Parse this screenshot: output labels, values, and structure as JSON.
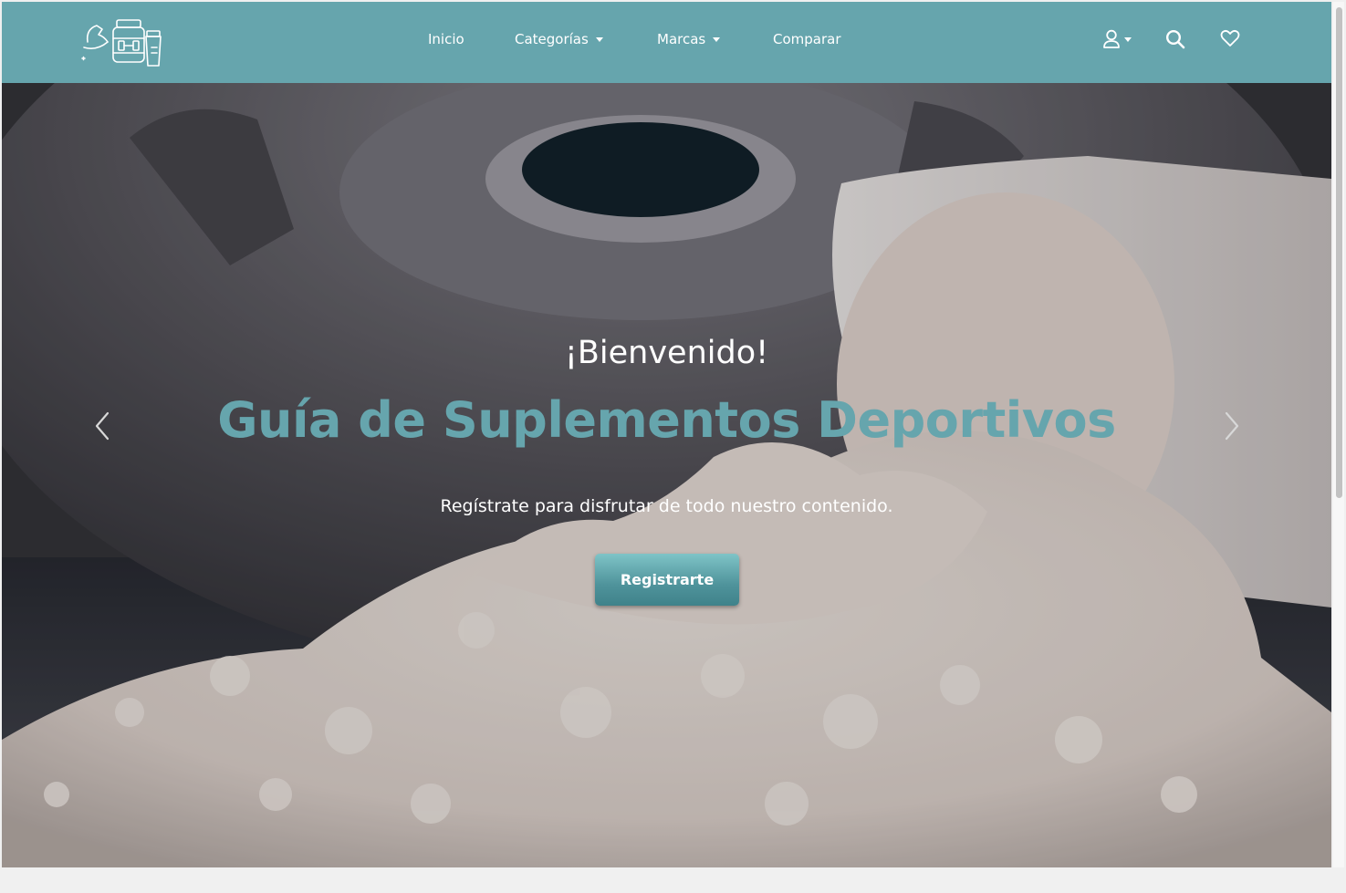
{
  "nav": {
    "logo_name": "supplements-logo",
    "links": [
      {
        "label": "Inicio"
      },
      {
        "label": "Categorías"
      },
      {
        "label": "Marcas"
      },
      {
        "label": "Comparar"
      }
    ],
    "icons": [
      "user-icon",
      "search-icon",
      "heart-icon"
    ]
  },
  "hero": {
    "welcome": "¡Bienvenido!",
    "title": "Guía de Suplementos Deportivos",
    "subtitle": "Regístrate para disfrutar de todo nuestro contenido.",
    "cta_label": "Registrarte"
  },
  "colors": {
    "navbar": "#66a5ad",
    "accent": "#66a5ad",
    "button_top": "#7fc4c7",
    "button_bottom": "#3f828a"
  }
}
